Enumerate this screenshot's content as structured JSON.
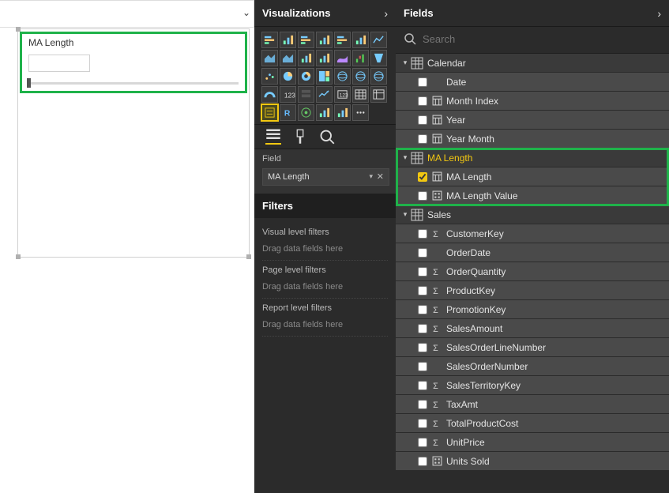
{
  "panels": {
    "viz_title": "Visualizations",
    "fields_title": "Fields",
    "filters_title": "Filters"
  },
  "slicer": {
    "title": "MA Length"
  },
  "field_well": {
    "label": "Field",
    "value": "MA Length"
  },
  "filters": {
    "visual_label": "Visual level filters",
    "page_label": "Page level filters",
    "report_label": "Report level filters",
    "drop_hint": "Drag data fields here"
  },
  "search": {
    "placeholder": "Search"
  },
  "viz_icons": [
    "stacked-bar",
    "stacked-column",
    "clustered-bar",
    "clustered-column",
    "100-stacked-bar",
    "100-stacked-column",
    "line",
    "area",
    "stacked-area",
    "line-stacked-column",
    "line-clustered-column",
    "ribbon",
    "waterfall",
    "funnel",
    "scatter",
    "pie",
    "donut",
    "treemap",
    "map",
    "filled-map",
    "shape-map",
    "gauge",
    "card",
    "multi-row-card",
    "kpi",
    "slicer-numeric",
    "table",
    "matrix",
    "slicer",
    "r-visual",
    "arcgis",
    "custom-visual-1",
    "custom-visual-2",
    "ellipsis"
  ],
  "tables": [
    {
      "name": "Calendar",
      "expanded": true,
      "fields": [
        {
          "name": "Date",
          "type": "none",
          "checked": false
        },
        {
          "name": "Month Index",
          "type": "calc",
          "checked": false
        },
        {
          "name": "Year",
          "type": "calc",
          "checked": false
        },
        {
          "name": "Year Month",
          "type": "calc",
          "checked": false
        }
      ]
    },
    {
      "name": "MA Length",
      "expanded": true,
      "highlight": "gold",
      "fields": [
        {
          "name": "MA Length",
          "type": "calc",
          "checked": true
        },
        {
          "name": "MA Length Value",
          "type": "measure",
          "checked": false
        }
      ]
    },
    {
      "name": "Sales",
      "expanded": true,
      "fields": [
        {
          "name": "CustomerKey",
          "type": "sum",
          "checked": false
        },
        {
          "name": "OrderDate",
          "type": "none",
          "checked": false
        },
        {
          "name": "OrderQuantity",
          "type": "sum",
          "checked": false
        },
        {
          "name": "ProductKey",
          "type": "sum",
          "checked": false
        },
        {
          "name": "PromotionKey",
          "type": "sum",
          "checked": false
        },
        {
          "name": "SalesAmount",
          "type": "sum",
          "checked": false
        },
        {
          "name": "SalesOrderLineNumber",
          "type": "sum",
          "checked": false
        },
        {
          "name": "SalesOrderNumber",
          "type": "none",
          "checked": false
        },
        {
          "name": "SalesTerritoryKey",
          "type": "sum",
          "checked": false
        },
        {
          "name": "TaxAmt",
          "type": "sum",
          "checked": false
        },
        {
          "name": "TotalProductCost",
          "type": "sum",
          "checked": false
        },
        {
          "name": "UnitPrice",
          "type": "sum",
          "checked": false
        },
        {
          "name": "Units Sold",
          "type": "measure",
          "checked": false
        }
      ]
    }
  ]
}
